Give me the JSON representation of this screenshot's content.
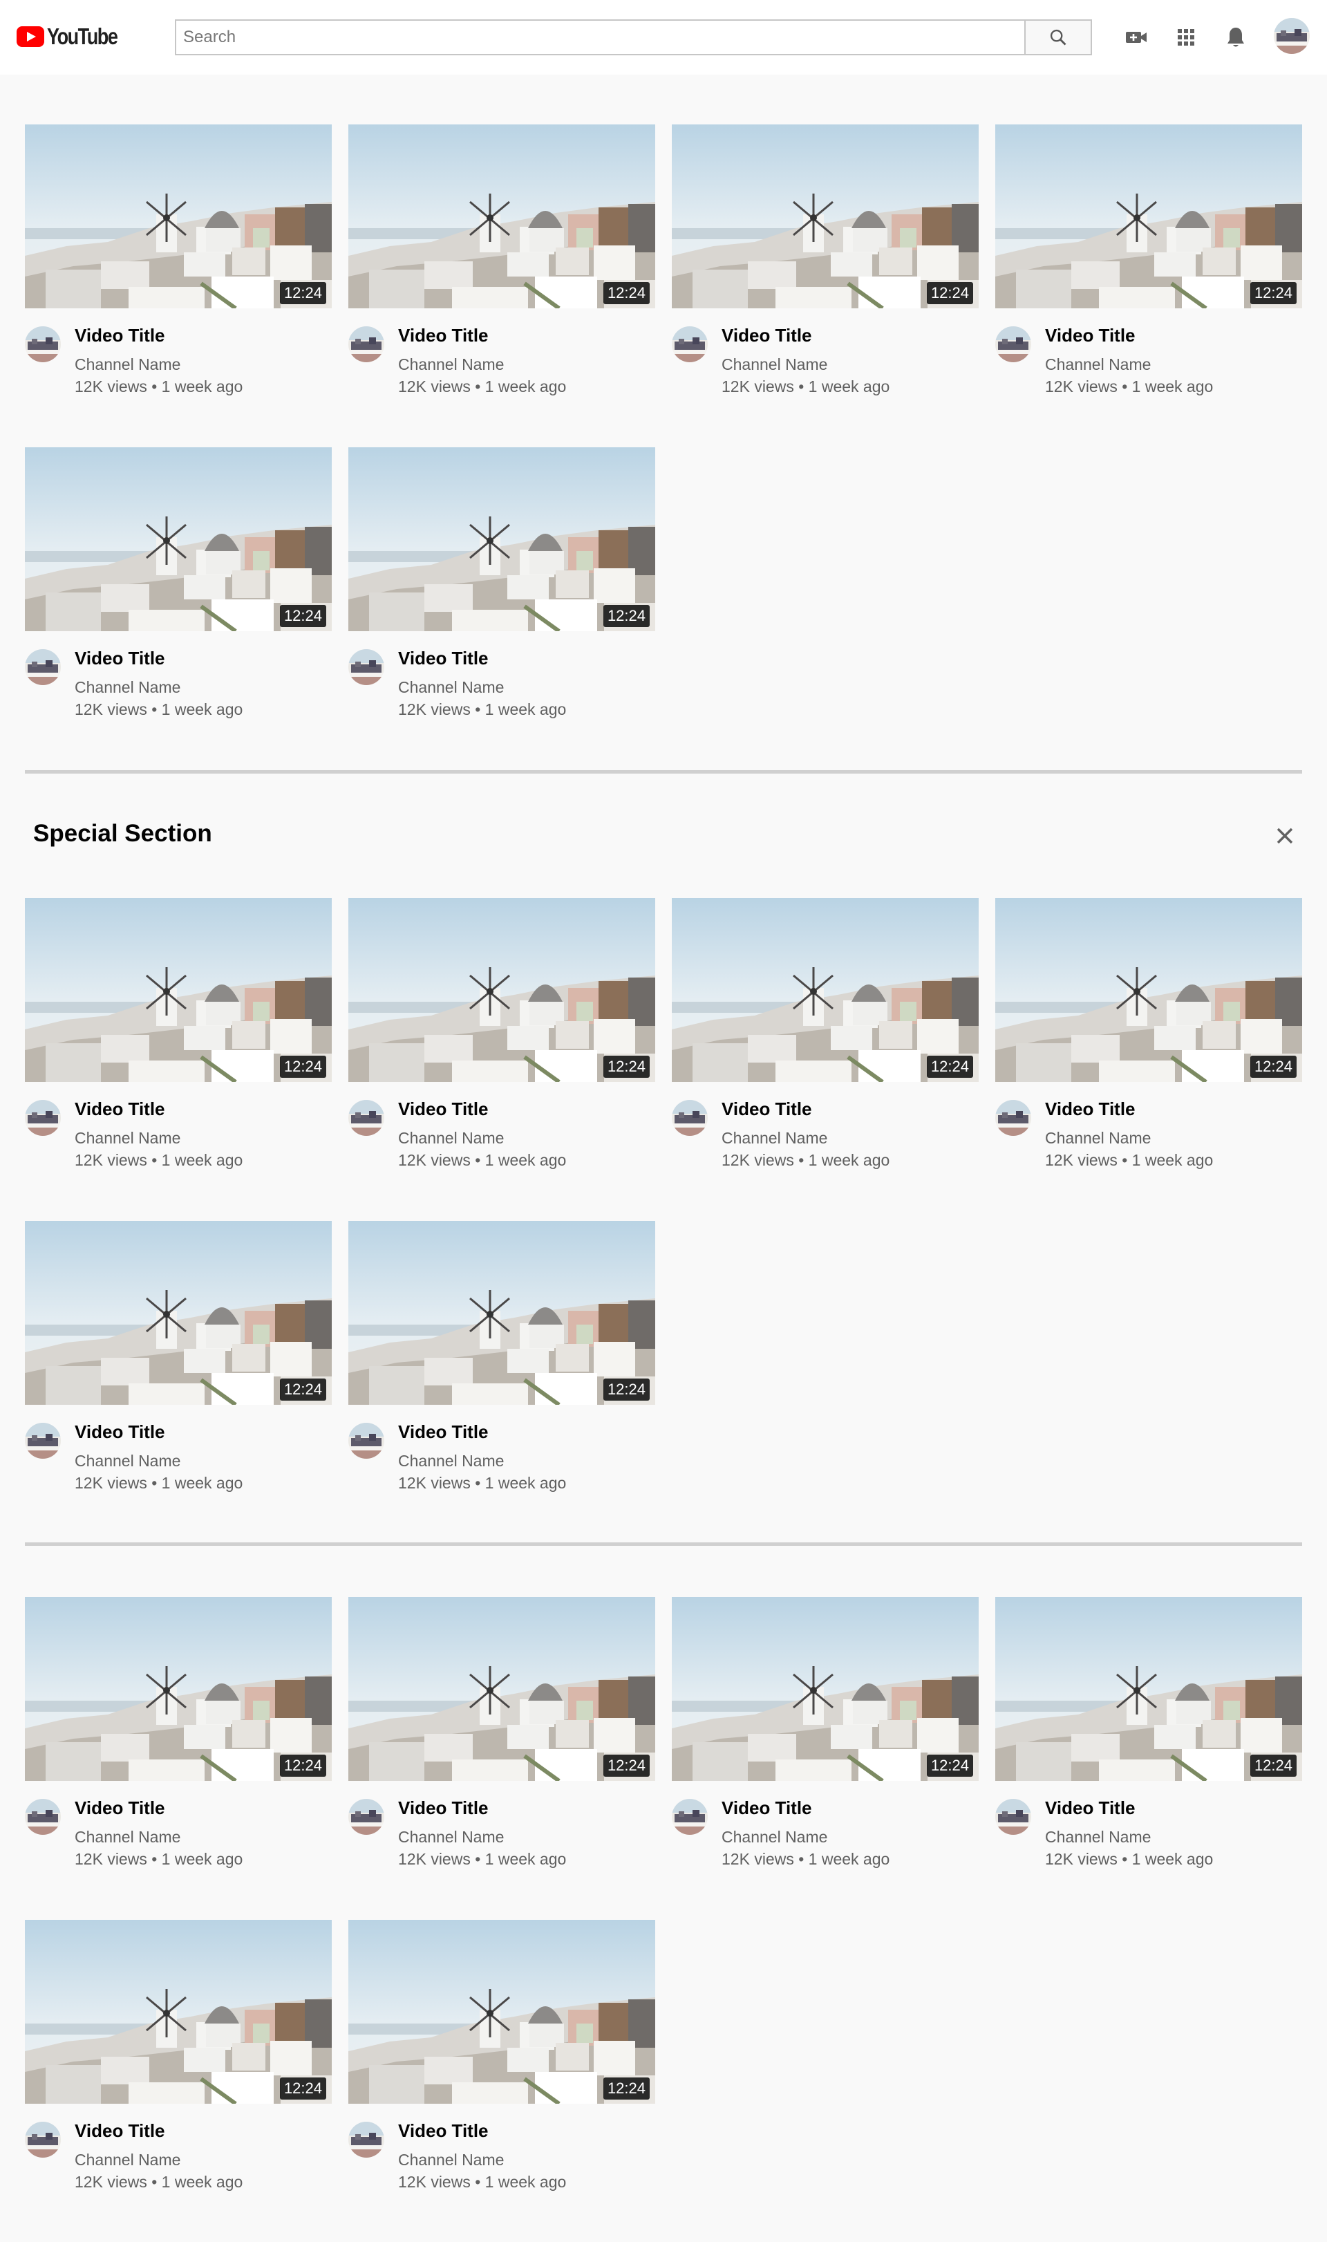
{
  "header": {
    "logo_text": "YouTube",
    "search_placeholder": "Search",
    "icons": [
      "create-video-icon",
      "apps-grid-icon",
      "notifications-bell-icon"
    ]
  },
  "colors": {
    "brand": "#ff0000",
    "background": "#f9f9f9"
  },
  "special_section": {
    "title": "Special Section",
    "close_icon": "close-icon"
  },
  "video": {
    "title": "Video Title",
    "channel": "Channel Name",
    "stats": "12K views • 1 week ago",
    "duration": "12:24"
  },
  "sections": [
    {
      "rows": [
        4,
        2
      ]
    },
    {
      "rows": [
        4,
        2
      ],
      "title": "Special Section"
    },
    {
      "rows": [
        4,
        2
      ]
    }
  ]
}
